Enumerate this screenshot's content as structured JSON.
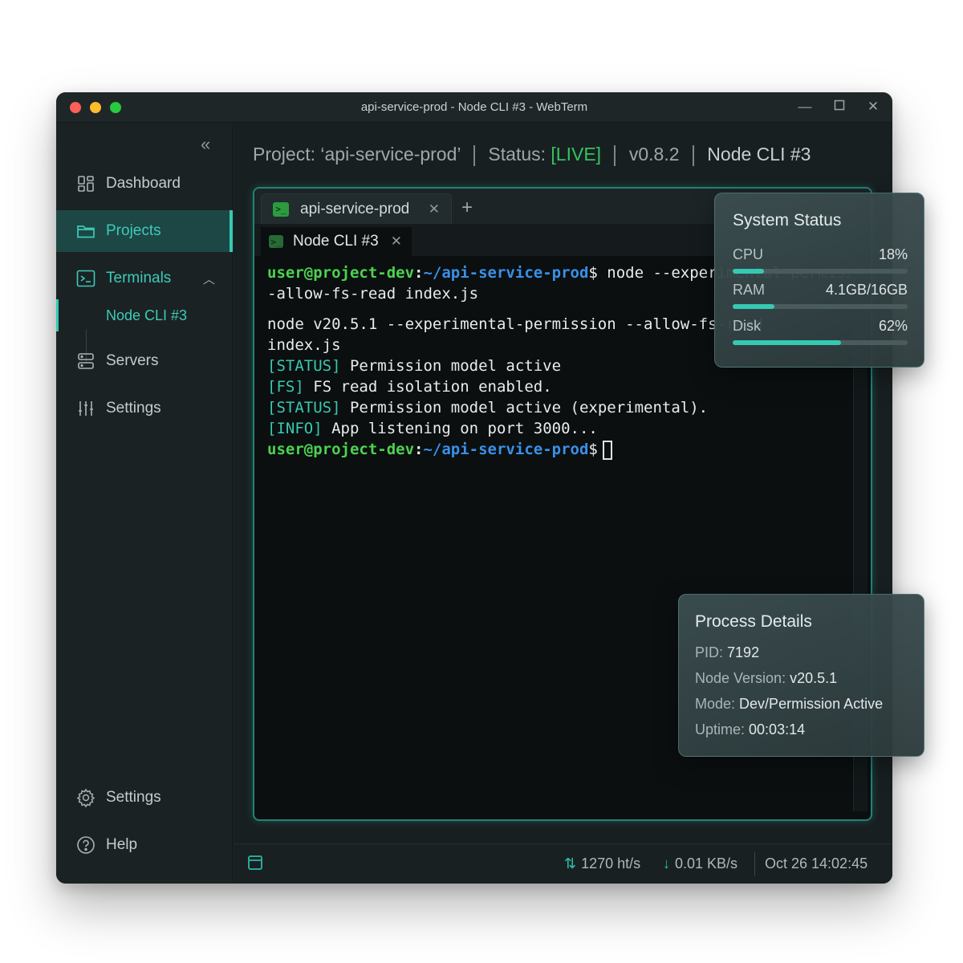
{
  "window": {
    "title": "api-service-prod - Node CLI #3 - WebTerm"
  },
  "sidebar": {
    "items": [
      {
        "label": "Dashboard"
      },
      {
        "label": "Projects"
      },
      {
        "label": "Terminals"
      },
      {
        "label": "Node CLI #3"
      },
      {
        "label": "Servers"
      },
      {
        "label": "Settings"
      }
    ],
    "bottom": [
      {
        "label": "Settings"
      },
      {
        "label": "Help"
      }
    ]
  },
  "header": {
    "project_label": "Project:",
    "project_name": "‘api-service-prod’",
    "status_label": "Status:",
    "status_value": "[LIVE]",
    "version": "v0.8.2",
    "cli": "Node CLI #3"
  },
  "tabs": {
    "outer": "api-service-prod",
    "inner": "Node CLI #3"
  },
  "terminal": {
    "prompt_user": "user@project-dev",
    "prompt_path": "~/api-service-prod",
    "command_1": "node --experimental-permission -",
    "command_1_cont": "-allow-fs-read index.js",
    "output_1": "node v20.5.1 --experimental-permission --allow-fs-read",
    "output_1_cont": "index.js",
    "tag_status": "[STATUS]",
    "tag_fs": "[FS]",
    "tag_info": "[INFO]",
    "msg_1": "Permission model active",
    "msg_2": "FS read isolation enabled.",
    "msg_3": "Permission model active (experimental).",
    "msg_4": "App listening on port 3000..."
  },
  "system_status": {
    "title": "System Status",
    "metrics": [
      {
        "label": "CPU",
        "value": "18%",
        "level": 0.18
      },
      {
        "label": "RAM",
        "value": "4.1GB/16GB",
        "level": 0.24
      },
      {
        "label": "Disk",
        "value": "62%",
        "level": 0.62
      }
    ],
    "accent": "#35c9b3"
  },
  "process": {
    "title": "Process Details",
    "pid_label": "PID:",
    "pid": "7192",
    "node_label": "Node Version:",
    "node": "v20.5.1",
    "mode_label": "Mode:",
    "mode": "Dev/Permission Active",
    "uptime_label": "Uptime:",
    "uptime": "00:03:14"
  },
  "statusbar": {
    "upload": "1270 ht/s",
    "download": "0.01 KB/s",
    "datetime": "Oct 26 14:02:45"
  },
  "colors": {
    "live": "#35c35e",
    "accent": "#35c9b3",
    "user": "#4cd24f",
    "path": "#3a90e8"
  }
}
